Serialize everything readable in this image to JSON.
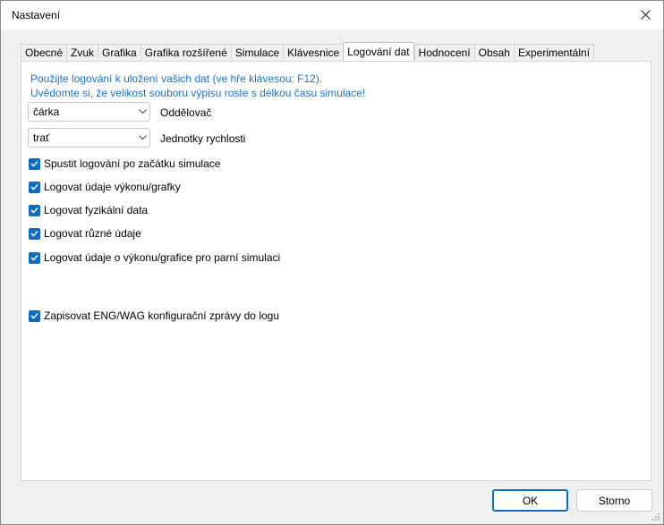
{
  "window": {
    "title": "Nastavení"
  },
  "tabs": [
    {
      "label": "Obecné"
    },
    {
      "label": "Zvuk"
    },
    {
      "label": "Grafika"
    },
    {
      "label": "Grafika rozšířené"
    },
    {
      "label": "Simulace"
    },
    {
      "label": "Klávesnice"
    },
    {
      "label": "Logování dat"
    },
    {
      "label": "Hodnocení"
    },
    {
      "label": "Obsah"
    },
    {
      "label": "Experimentální"
    }
  ],
  "active_tab": "Logování dat",
  "panel": {
    "info_line1": "Použijte logování k uložení vašich dat (ve hře klávesou: F12).",
    "info_line2": "Uvědomte si, že velikost souboru výpisu roste s délkou času simulace!",
    "separator": {
      "value": "čárka",
      "label": "Oddělovač"
    },
    "speed_units": {
      "value": "trať",
      "label": "Jednotky rychlosti"
    },
    "checkboxes": [
      {
        "label": "Spustit logování po začátku simulace",
        "checked": true
      },
      {
        "label": "Logovat údaje výkonu/grafky",
        "checked": true
      },
      {
        "label": "Logovat fyzikální data",
        "checked": true
      },
      {
        "label": "Logovat různé údaje",
        "checked": true
      },
      {
        "label": "Logovat údaje o výkonu/grafice pro parní simulaci",
        "checked": true
      },
      {
        "label": "Zapisovat ENG/WAG konfigurační zprávy do logu",
        "checked": true
      }
    ]
  },
  "buttons": {
    "ok": "OK",
    "cancel": "Storno"
  },
  "colors": {
    "accent": "#0f6cbd",
    "info_text": "#1a73c8"
  }
}
